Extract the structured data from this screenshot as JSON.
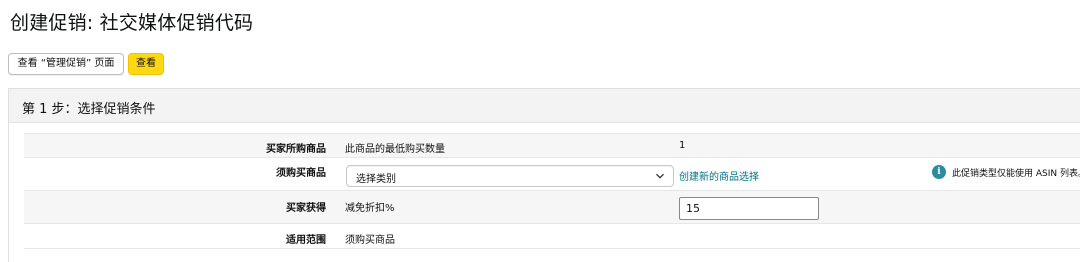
{
  "page": {
    "title": "创建促销: 社交媒体促销代码"
  },
  "toolbar": {
    "view_manage_label": "查看 “管理促销” 页面",
    "view_label": "查看"
  },
  "step": {
    "title": "第 1 步：选择促销条件"
  },
  "rows": [
    {
      "label": "买家所购商品",
      "condition": "此商品的最低购买数量",
      "value": "1"
    },
    {
      "label": "须购买商品",
      "select_value": "选择类别",
      "link": "创建新的商品选择",
      "info": "此促销类型仅能使用 ASIN 列表。"
    },
    {
      "label": "买家获得",
      "condition": "减免折扣%",
      "input_value": "15"
    },
    {
      "label": "适用范围",
      "condition": "须购买商品"
    }
  ],
  "icons": {
    "select_arrow": "chevron-down-icon",
    "info": "info-icon"
  },
  "colors": {
    "primary_button": "#ffd814",
    "link": "#007185",
    "info_icon": "#2c8ba3"
  }
}
